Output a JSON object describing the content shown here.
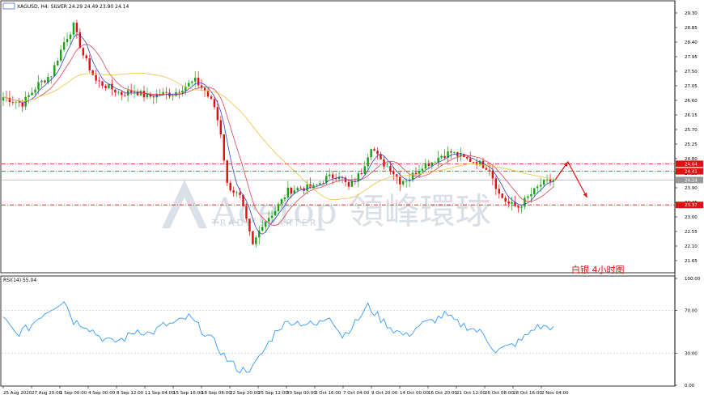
{
  "header": {
    "symbol_line": "XAGUSD, H4: SILVER 24.29 24.49 23.90 24.14",
    "rsi_label": "RSI(14) 55.04"
  },
  "watermark": {
    "text": "Acetop 領峰環球",
    "sub": "TRADE SMARTER"
  },
  "annotation": {
    "text": "白银 4小时图",
    "color": "#dd1111"
  },
  "price_axis": {
    "ticks": [
      "29.30",
      "28.85",
      "28.40",
      "27.95",
      "27.50",
      "27.05",
      "26.60",
      "26.15",
      "25.70",
      "25.25",
      "24.80",
      "24.35",
      "23.90",
      "23.45",
      "23.00",
      "22.55",
      "22.10",
      "21.65"
    ],
    "markers": [
      {
        "label": "24.64",
        "value": 24.64,
        "bg": "#dd1111"
      },
      {
        "label": "24.41",
        "value": 24.41,
        "bg": "#dd1111"
      },
      {
        "label": "24.14",
        "value": 24.14,
        "bg": "#999999"
      },
      {
        "label": "23.37",
        "value": 23.37,
        "bg": "#dd1111"
      }
    ]
  },
  "rsi_axis": {
    "ticks": [
      "100.00",
      "70.00",
      "30.00",
      "0.00"
    ]
  },
  "time_axis": {
    "ticks": [
      "25 Aug 2020",
      "27 Aug 20:00",
      "1 Sep 00:00",
      "4 Sep 00:00",
      "8 Sep 12:00",
      "11 Sep 04:00",
      "15 Sep 16:00",
      "18 Sep 08:00",
      "22 Sep 20:00",
      "25 Sep 12:00",
      "30 Sep 00:00",
      "2 Oct 16:00",
      "7 Oct 04:00",
      "9 Oct 20:00",
      "14 Oct 00:00",
      "16 Oct 20:00",
      "21 Oct 12:00",
      "26 Oct 08:00",
      "28 Oct 16:00",
      "2 Nov 04:00"
    ]
  },
  "colors": {
    "bull": "#1aa31a",
    "bear": "#dd1111",
    "ma_fast": "#3344cc",
    "ma_mid": "#dd4455",
    "ma_slow": "#f0c040",
    "rsi": "#1e90ff",
    "hline": "#dd1111",
    "grid": "#cccccc"
  },
  "chart_data": [
    {
      "type": "candlestick",
      "title": "XAGUSD, H4: SILVER",
      "ylim": [
        21.45,
        29.55
      ],
      "horizontal_levels": [
        24.64,
        24.41,
        24.14,
        23.37
      ],
      "moving_averages": [
        "fast",
        "mid",
        "slow"
      ],
      "path_points": [
        [
          0,
          26.7
        ],
        [
          6,
          26.5
        ],
        [
          11,
          27.1
        ],
        [
          15,
          27.4
        ],
        [
          19,
          28.4
        ],
        [
          22,
          28.9
        ],
        [
          25,
          28.0
        ],
        [
          29,
          27.2
        ],
        [
          33,
          27.0
        ],
        [
          37,
          26.8
        ],
        [
          41,
          26.9
        ],
        [
          45,
          26.7
        ],
        [
          49,
          26.8
        ],
        [
          53,
          26.8
        ],
        [
          56,
          27.0
        ],
        [
          60,
          27.2
        ],
        [
          63,
          26.9
        ],
        [
          66,
          26.4
        ],
        [
          68,
          25.6
        ],
        [
          70,
          24.0
        ],
        [
          74,
          23.6
        ],
        [
          78,
          22.1
        ],
        [
          81,
          22.8
        ],
        [
          85,
          23.2
        ],
        [
          89,
          23.8
        ],
        [
          93,
          23.9
        ],
        [
          97,
          23.9
        ],
        [
          101,
          24.2
        ],
        [
          105,
          24.3
        ],
        [
          108,
          23.9
        ],
        [
          112,
          24.4
        ],
        [
          115,
          25.2
        ],
        [
          118,
          24.7
        ],
        [
          121,
          24.5
        ],
        [
          124,
          24.1
        ],
        [
          127,
          24.2
        ],
        [
          131,
          24.6
        ],
        [
          134,
          24.7
        ],
        [
          137,
          24.9
        ],
        [
          140,
          25.0
        ],
        [
          144,
          24.8
        ],
        [
          148,
          24.7
        ],
        [
          152,
          24.5
        ],
        [
          155,
          23.7
        ],
        [
          158,
          23.4
        ],
        [
          161,
          23.3
        ],
        [
          164,
          23.6
        ],
        [
          168,
          24.0
        ],
        [
          172,
          24.14
        ]
      ],
      "projection": [
        [
          172,
          24.14
        ],
        [
          176,
          24.7
        ],
        [
          182,
          23.6
        ]
      ]
    },
    {
      "type": "line",
      "title": "RSI(14) 55.04",
      "ylim": [
        0,
        100
      ],
      "levels": [
        70,
        30
      ],
      "series": [
        {
          "name": "RSI(14)",
          "points": [
            [
              0,
              62
            ],
            [
              4,
              48
            ],
            [
              8,
              54
            ],
            [
              12,
              66
            ],
            [
              16,
              74
            ],
            [
              19,
              80
            ],
            [
              22,
              60
            ],
            [
              26,
              56
            ],
            [
              30,
              46
            ],
            [
              34,
              40
            ],
            [
              38,
              44
            ],
            [
              42,
              52
            ],
            [
              46,
              48
            ],
            [
              50,
              56
            ],
            [
              54,
              58
            ],
            [
              58,
              64
            ],
            [
              62,
              52
            ],
            [
              66,
              40
            ],
            [
              70,
              24
            ],
            [
              74,
              14
            ],
            [
              78,
              16
            ],
            [
              82,
              35
            ],
            [
              86,
              54
            ],
            [
              90,
              60
            ],
            [
              94,
              58
            ],
            [
              98,
              56
            ],
            [
              102,
              66
            ],
            [
              106,
              46
            ],
            [
              110,
              58
            ],
            [
              114,
              74
            ],
            [
              118,
              62
            ],
            [
              122,
              52
            ],
            [
              126,
              46
            ],
            [
              130,
              56
            ],
            [
              134,
              60
            ],
            [
              138,
              66
            ],
            [
              142,
              58
            ],
            [
              146,
              54
            ],
            [
              150,
              48
            ],
            [
              154,
              32
            ],
            [
              158,
              36
            ],
            [
              162,
              42
            ],
            [
              166,
              54
            ],
            [
              172,
              55.04
            ]
          ]
        }
      ]
    }
  ]
}
